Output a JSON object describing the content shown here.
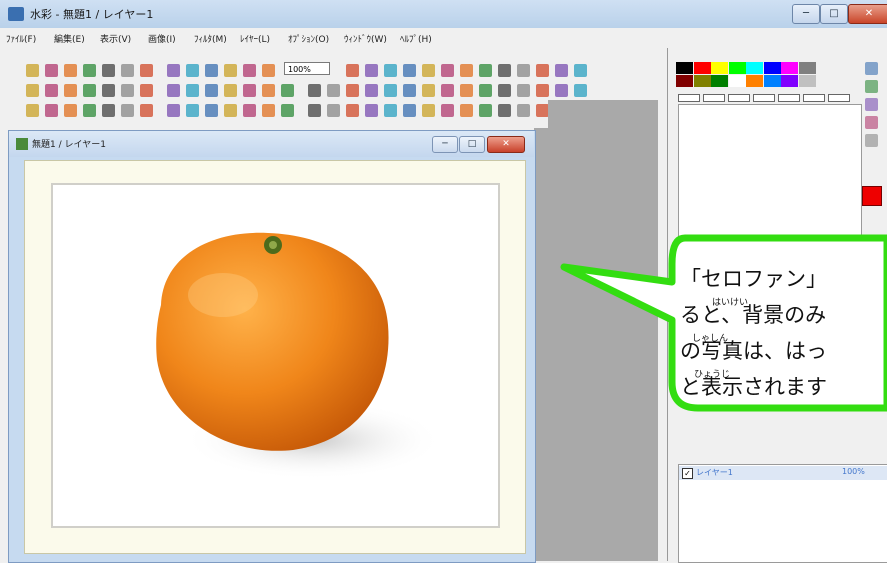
{
  "window": {
    "title": "水彩 - 無題1 / レイヤー1",
    "min_label": "─",
    "max_label": "□",
    "close_label": "✕"
  },
  "menu": [
    "ﾌｧｲﾙ(F)",
    "編集(E)",
    "表示(V)",
    "画像(I)",
    "ﾌｨﾙﾀ(M)",
    "ﾚｲﾔｰ(L)",
    "ｵﾌﾟｼｮﾝ(O)",
    "ｳｨﾝﾄﾞｳ(W)",
    "ﾍﾙﾌﾟ(H)"
  ],
  "toolbar": {
    "zoom_value": "100%"
  },
  "document": {
    "title": "無題1 / レイヤー1",
    "min_label": "─",
    "max_label": "□",
    "close_label": "✕"
  },
  "layer_panel": {
    "check": "✓",
    "layer_name": "レイヤー1",
    "opacity": "100%"
  },
  "callout": {
    "line1": "「セロファン」",
    "line2": "ると、背景のみ",
    "line3": "の写真は、はっ",
    "line4": "と表示されます",
    "ruby_haikei": "はいけい",
    "ruby_shashin": "しゃしん",
    "ruby_hyouji": "ひょうじ"
  },
  "colors": {
    "callout_border": "#33dd11",
    "orange": "#f08a1a",
    "foreground": "#ee0000"
  },
  "palette_colors": [
    "#000000",
    "#ff0000",
    "#ffff00",
    "#00ff00",
    "#00ffff",
    "#0000ff",
    "#ff00ff",
    "#808080",
    "#800000",
    "#808000",
    "#008000",
    "#ffffff",
    "#ff8000",
    "#0080ff",
    "#8000ff",
    "#c0c0c0"
  ]
}
